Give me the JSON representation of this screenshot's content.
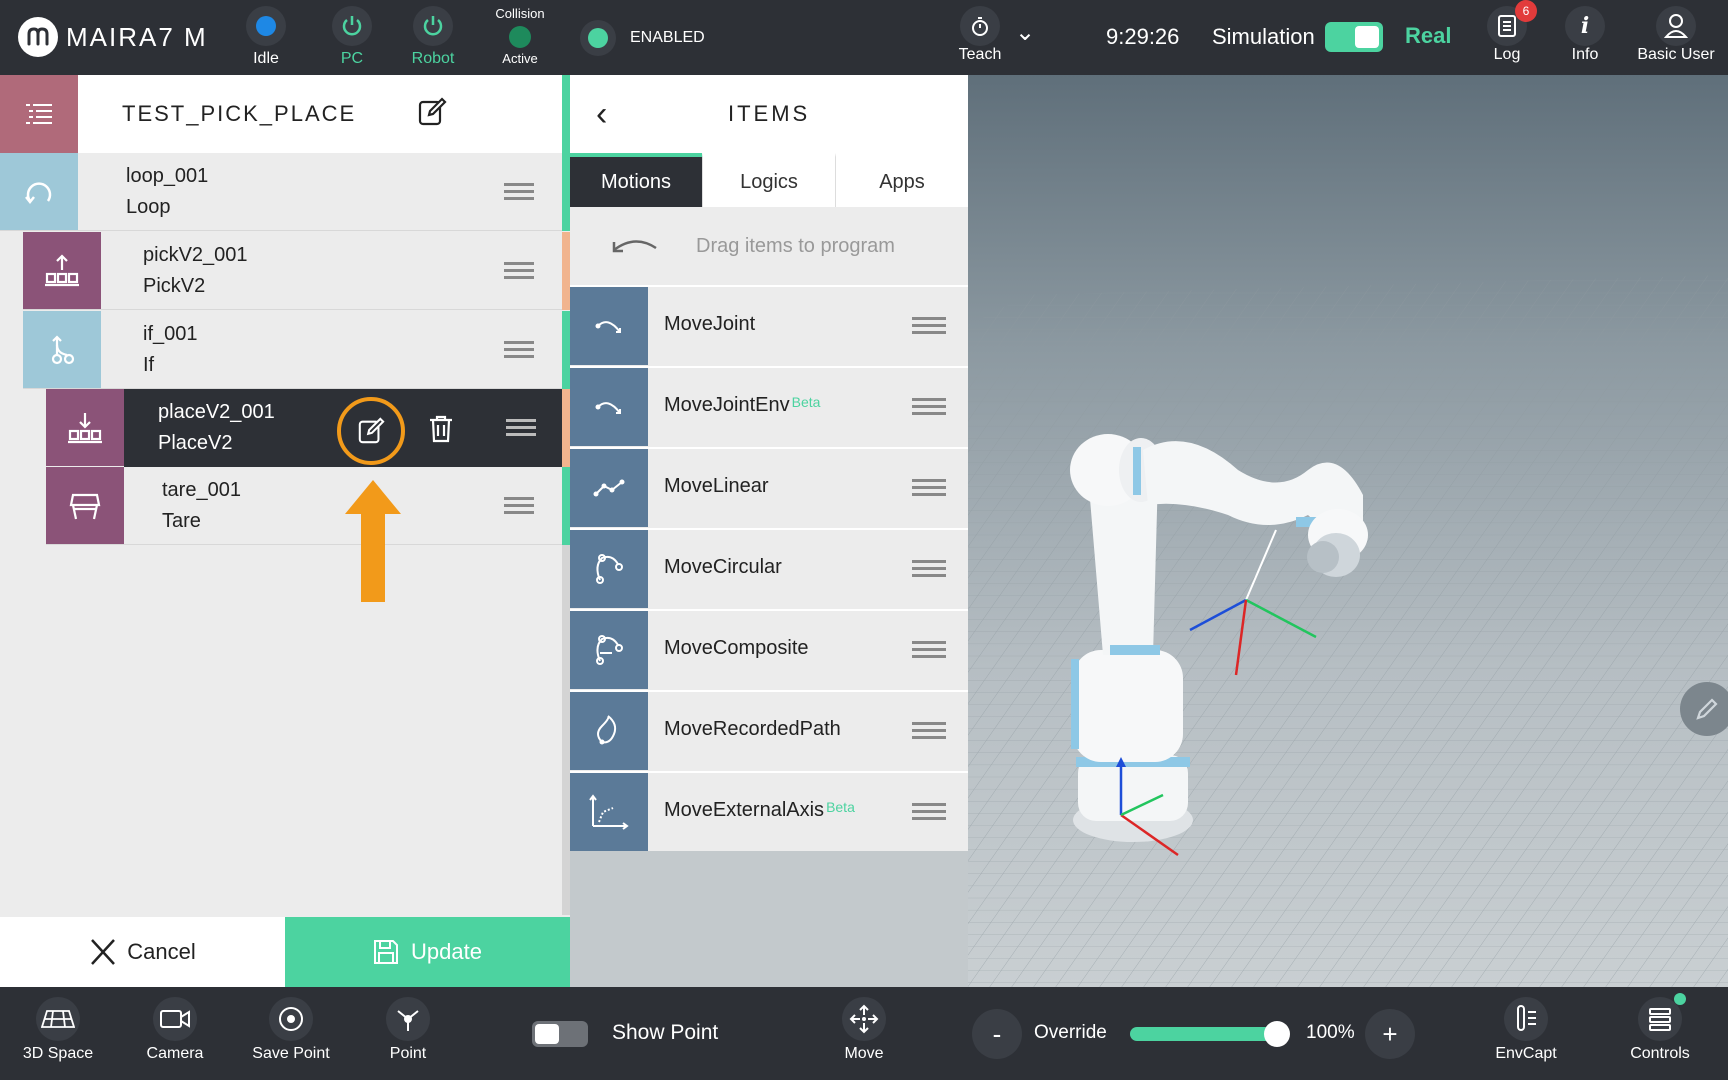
{
  "topbar": {
    "brand": "MAIRA7 M",
    "status_idle": "Idle",
    "status_pc": "PC",
    "status_robot": "Robot",
    "collision_title": "Collision",
    "collision_state": "Active",
    "enabled_label": "ENABLED",
    "teach_label": "Teach",
    "time": "9:29:26",
    "simulation_label": "Simulation",
    "real_label": "Real",
    "log_label": "Log",
    "log_count": "6",
    "info_label": "Info",
    "user_label": "Basic User",
    "colors": {
      "idle_dot": "#1e88e5",
      "pc": "#4cd3a0",
      "robot": "#4cd3a0",
      "accent": "#4cd3a0"
    }
  },
  "program": {
    "title": "TEST_PICK_PLACE",
    "rows": [
      {
        "name": "loop_001",
        "type": "Loop"
      },
      {
        "name": "pickV2_001",
        "type": "PickV2"
      },
      {
        "name": "if_001",
        "type": "If"
      },
      {
        "name": "placeV2_001",
        "type": "PlaceV2"
      },
      {
        "name": "tare_001",
        "type": "Tare"
      }
    ],
    "cancel_label": "Cancel",
    "update_label": "Update"
  },
  "items": {
    "title": "ITEMS",
    "tabs": [
      "Motions",
      "Logics",
      "Apps"
    ],
    "drag_hint": "Drag items to program",
    "motions": [
      {
        "label": "MoveJoint",
        "beta": ""
      },
      {
        "label": "MoveJointEnv",
        "beta": "Beta"
      },
      {
        "label": "MoveLinear",
        "beta": ""
      },
      {
        "label": "MoveCircular",
        "beta": ""
      },
      {
        "label": "MoveComposite",
        "beta": ""
      },
      {
        "label": "MoveRecordedPath",
        "beta": ""
      },
      {
        "label": "MoveExternalAxis",
        "beta": "Beta"
      }
    ]
  },
  "bottombar": {
    "space_label": "3D Space",
    "camera_label": "Camera",
    "savepoint_label": "Save Point",
    "point_label": "Point",
    "showpoint_label": "Show Point",
    "move_label": "Move",
    "override_label": "Override",
    "override_minus": "-",
    "override_plus": "+",
    "override_value": "100%",
    "envcapt_label": "EnvCapt",
    "controls_label": "Controls"
  }
}
